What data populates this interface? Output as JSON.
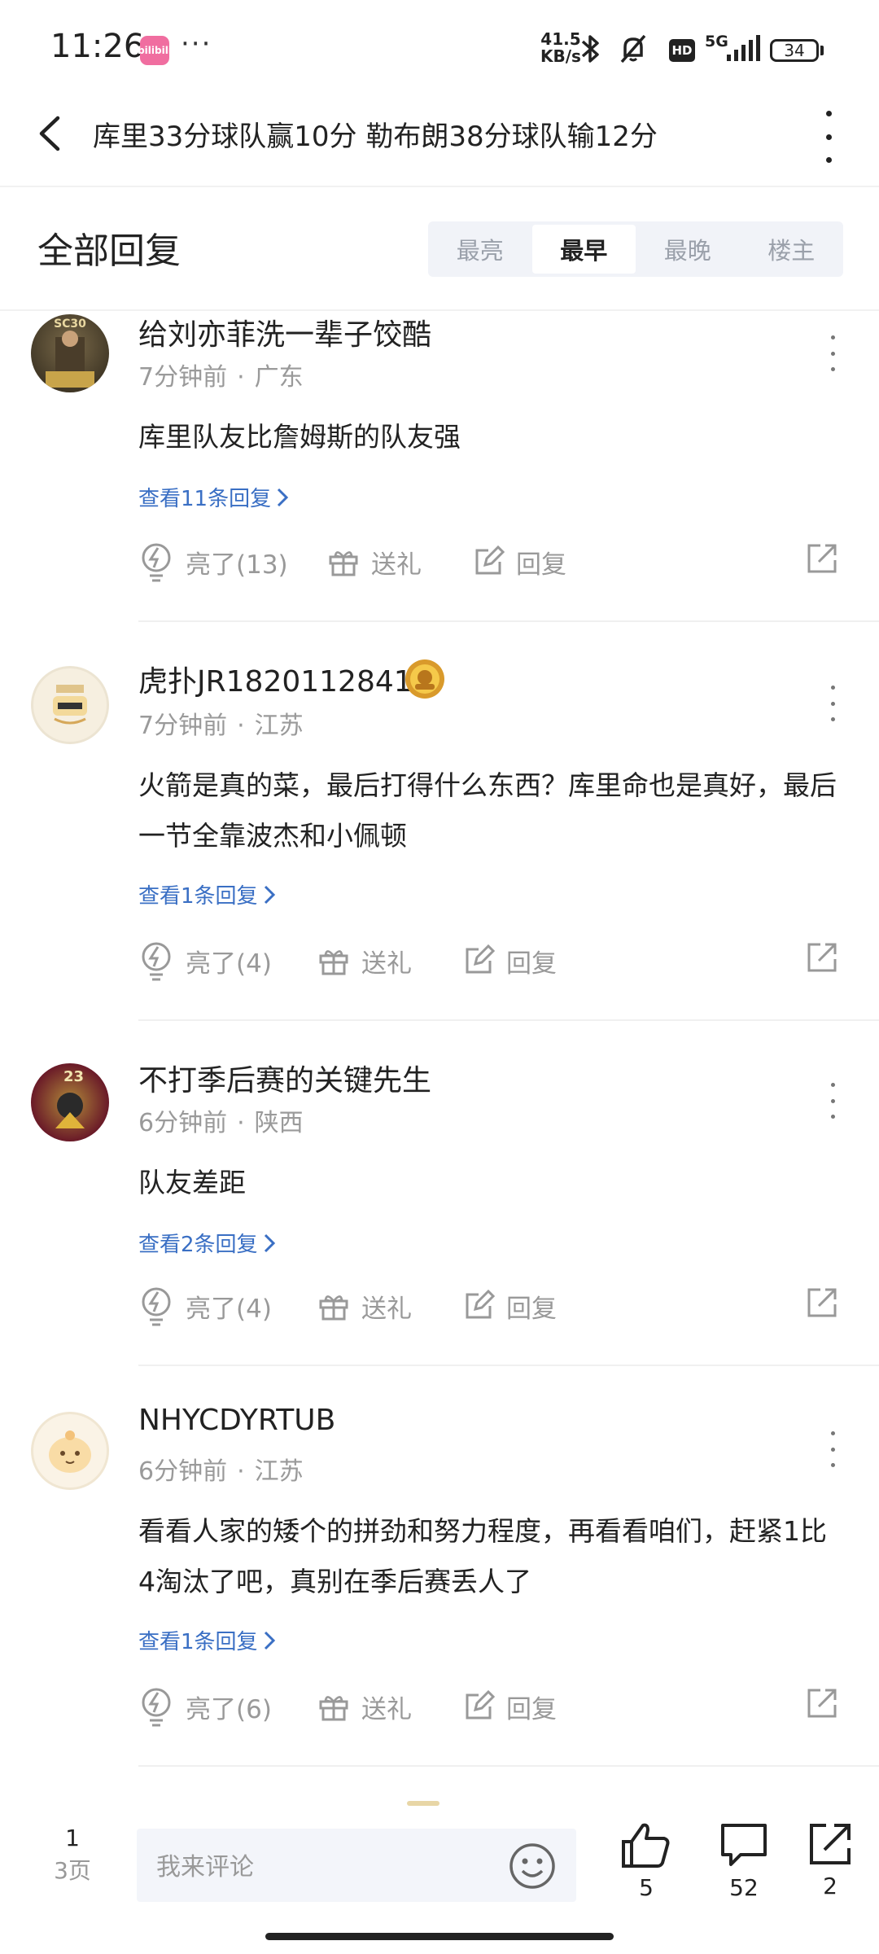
{
  "status_bar": {
    "time": "11:26",
    "app_badge": "bilibili",
    "dots": "···",
    "net_speed_value": "41.5",
    "net_speed_unit": "KB/s",
    "hd": "HD",
    "network": "5G",
    "battery": "34"
  },
  "header": {
    "title": "库里33分球队赢10分 勒布朗38分球队输12分"
  },
  "section": {
    "title": "全部回复",
    "sort_tabs": [
      "最亮",
      "最早",
      "最晚",
      "楼主"
    ],
    "active_tab": "最早"
  },
  "comments": [
    {
      "username": "给刘亦菲洗一辈子饺酷",
      "time": "7分钟前",
      "location": "广东",
      "content": "库里队友比詹姆斯的队友强",
      "replies": "查看11条回复",
      "likes": "亮了(13)",
      "gift": "送礼",
      "reply": "回复",
      "avatar_text": "SC30"
    },
    {
      "username": "虎扑JR1820112841",
      "time": "7分钟前",
      "location": "江苏",
      "content": "火箭是真的菜，最后打得什么东西？库里命也是真好，最后一节全靠波杰和小佩顿",
      "replies": "查看1条回复",
      "likes": "亮了(4)",
      "gift": "送礼",
      "reply": "回复"
    },
    {
      "username": "不打季后赛的关键先生",
      "time": "6分钟前",
      "location": "陕西",
      "content": "队友差距",
      "replies": "查看2条回复",
      "likes": "亮了(4)",
      "gift": "送礼",
      "reply": "回复",
      "avatar_text": "23"
    },
    {
      "username": "NHYCDYRTUB",
      "time": "6分钟前",
      "location": "江苏",
      "content": "看看人家的矮个的拼劲和努力程度，再看看咱们，赶紧1比4淘汰了吧，真别在季后赛丢人了",
      "replies": "查看1条回复",
      "likes": "亮了(6)",
      "gift": "送礼",
      "reply": "回复"
    }
  ],
  "bottom_bar": {
    "page_current": "1",
    "page_total": "3页",
    "input_placeholder": "我来评论",
    "like_count": "5",
    "comment_count": "52",
    "share_count": "2"
  },
  "colors": {
    "link": "#3a6fc4",
    "muted": "#999999",
    "tab_bg": "#f1f3f8"
  }
}
